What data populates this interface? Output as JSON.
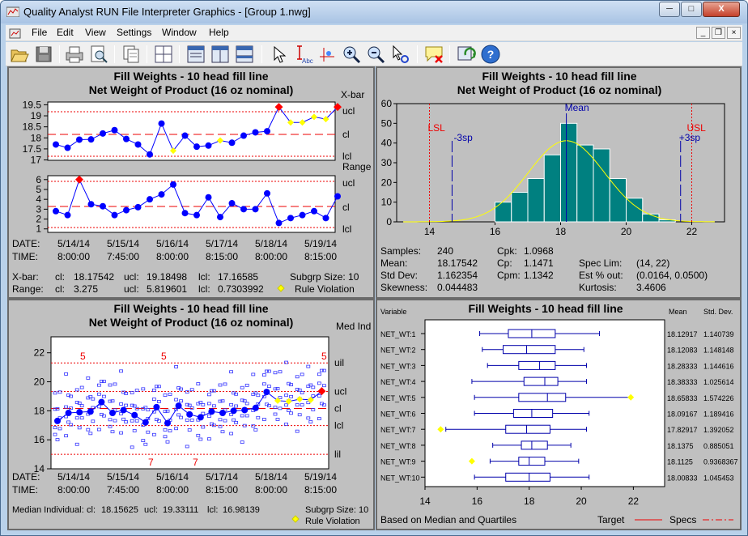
{
  "window": {
    "title": "Quality Analyst RUN File Interpreter Graphics - [Group 1.nwg]",
    "min": "─",
    "max": "□",
    "close": "X"
  },
  "menu": [
    "File",
    "Edit",
    "View",
    "Settings",
    "Window",
    "Help"
  ],
  "mdi": {
    "min": "_",
    "restore": "❐",
    "close": "×"
  },
  "toolbar": [
    "open-icon",
    "save-icon",
    "print-icon",
    "print-preview-icon",
    "copy-icon",
    "layout-grid-icon",
    "layout-single-icon",
    "layout-columns-icon",
    "layout-rows-icon",
    "pointer-icon",
    "text-annotation-icon",
    "point-label-icon",
    "zoom-in-icon",
    "zoom-out-icon",
    "select-point-icon",
    "clear-annotation-icon",
    "refresh-icon",
    "help-icon"
  ],
  "tooltext": {
    "abc": "Abc"
  },
  "xbar": {
    "title": "Fill Weights - 10 head fill line",
    "subtitle": "Net Weight of Product (16 oz nominal)",
    "chart_label": "X-bar",
    "range_label": "Range",
    "ticks": [
      "19.5",
      "19",
      "18.5",
      "18",
      "17.5",
      "17"
    ],
    "range_ticks": [
      "6",
      "5",
      "4",
      "3",
      "2",
      "1"
    ],
    "limits": {
      "ucl": "ucl",
      "cl": "cl",
      "lcl": "lcl"
    },
    "xbar_values": [
      17.7,
      17.55,
      17.92,
      17.93,
      18.2,
      18.35,
      17.95,
      17.7,
      17.25,
      18.65,
      17.42,
      18.1,
      17.6,
      17.65,
      17.88,
      17.78,
      18.1,
      18.25,
      18.3,
      19.4,
      18.7,
      18.7,
      18.95,
      18.85,
      19.4
    ],
    "range_values": [
      2.8,
      2.4,
      6.0,
      3.5,
      3.3,
      2.4,
      2.9,
      3.2,
      4.0,
      4.5,
      5.5,
      2.6,
      2.4,
      4.2,
      2.2,
      3.6,
      3.0,
      3.0,
      4.6,
      1.6,
      2.1,
      2.4,
      2.8,
      2.1,
      4.3
    ],
    "date_label": "DATE:",
    "time_label": "TIME:",
    "dates": [
      "5/14/14",
      "5/15/14",
      "5/16/14",
      "5/17/14",
      "5/18/14",
      "5/19/14"
    ],
    "times": [
      "8:00:00",
      "7:45:00",
      "8:00:00",
      "8:15:00",
      "8:00:00",
      "8:15:00"
    ],
    "stats": {
      "xbar": "X-bar:",
      "range": "Range:",
      "cl": "cl:",
      "ucl": "ucl:",
      "lcl": "lcl:",
      "xbar_cl": "18.17542",
      "xbar_ucl": "19.18498",
      "xbar_lcl": "17.16585",
      "range_cl": "3.275",
      "range_ucl": "5.819601",
      "range_lcl": "0.7303992",
      "subgrp": "Subgrp Size: 10",
      "rule": "Rule Violation"
    }
  },
  "histogram": {
    "title": "Fill Weights - 10 head fill line",
    "subtitle": "Net Weight of Product (16 oz nominal)",
    "yticks": [
      "60",
      "50",
      "40",
      "30",
      "20",
      "10",
      "0"
    ],
    "xticks": [
      "14",
      "16",
      "18",
      "20",
      "22"
    ],
    "labels": {
      "lsl": "LSL",
      "usl": "USL",
      "mean": "Mean",
      "m3": "-3sp",
      "p3": "+3sp"
    },
    "chart_data": {
      "type": "bar",
      "bins_start": 16,
      "bin_width": 0.5,
      "counts": [
        10,
        15,
        22,
        34,
        50,
        39,
        37,
        22,
        12,
        4,
        1
      ],
      "ylim": [
        0,
        60
      ],
      "xlim": [
        13,
        23
      ],
      "lsl": 14,
      "usl": 22,
      "mean": 18.17542,
      "minus3": 14.69,
      "plus3": 21.66
    },
    "stats": [
      [
        "Samples:",
        "240",
        "Cpk:",
        "1.0968",
        "",
        ""
      ],
      [
        "Mean:",
        "18.17542",
        "Cp:",
        "1.1471",
        "Spec Lim:",
        "(14, 22)"
      ],
      [
        "Std Dev:",
        "1.162354",
        "Cpm:",
        "1.1342",
        "Est % out:",
        "(0.0164, 0.0500)"
      ],
      [
        "Skewness:",
        "0.044483",
        "",
        "",
        "Kurtosis:",
        "3.4606"
      ]
    ]
  },
  "median": {
    "title": "Fill Weights - 10 head fill line",
    "subtitle": "Net Weight of Product (16 oz nominal)",
    "chart_label": "Med Ind",
    "yticks": [
      "22",
      "20",
      "18",
      "16",
      "14"
    ],
    "limits": {
      "uil": "uil",
      "ucl": "ucl",
      "cl": "cl",
      "lcl": "lcl",
      "lil": "lil"
    },
    "rule_top": [
      "5",
      "5",
      "5"
    ],
    "rule_bottom": [
      "7",
      "7"
    ],
    "median_values": [
      17.3,
      17.85,
      17.9,
      17.95,
      18.6,
      17.85,
      18.05,
      17.7,
      17.2,
      18.25,
      17.15,
      18.35,
      17.75,
      17.55,
      17.95,
      17.85,
      18.0,
      18.05,
      18.2,
      19.3,
      18.7,
      18.65,
      18.8,
      18.75,
      19.35
    ],
    "dates": [
      "5/14/14",
      "5/15/14",
      "5/16/14",
      "5/17/14",
      "5/18/14",
      "5/19/14"
    ],
    "times": [
      "8:00:00",
      "7:45:00",
      "8:00:00",
      "8:15:00",
      "8:00:00",
      "8:15:00"
    ],
    "date_label": "DATE:",
    "time_label": "TIME:",
    "stats": {
      "label": "Median Individual:",
      "cl": "cl:",
      "cl_v": "18.15625",
      "ucl": "ucl:",
      "ucl_v": "19.33111",
      "lcl": "lcl:",
      "lcl_v": "16.98139",
      "subgrp": "Subgrp Size: 10",
      "rule": "Rule Violation"
    }
  },
  "boxplot": {
    "title": "Fill Weights - 10 head fill line",
    "variable_label": "Variable",
    "mean_label": "Mean",
    "sd_label": "Std. Dev.",
    "xticks": [
      "14",
      "16",
      "18",
      "20",
      "22"
    ],
    "footer": "Based on Median and Quartiles",
    "target": "Target",
    "specs": "Specs",
    "rows": [
      {
        "name": "NET_WT:1",
        "mean": "18.12917",
        "sd": "1.140739",
        "min": 16.1,
        "q1": 17.2,
        "med": 18.1,
        "q3": 19.0,
        "max": 20.7
      },
      {
        "name": "NET_WT:2",
        "mean": "18.12083",
        "sd": "1.148148",
        "min": 16.2,
        "q1": 17.0,
        "med": 17.9,
        "q3": 19.0,
        "max": 20.1
      },
      {
        "name": "NET_WT:3",
        "mean": "18.28333",
        "sd": "1.144616",
        "min": 16.4,
        "q1": 17.6,
        "med": 18.4,
        "q3": 19.0,
        "max": 20.2
      },
      {
        "name": "NET_WT:4",
        "mean": "18.38333",
        "sd": "1.025614",
        "min": 15.8,
        "q1": 17.8,
        "med": 18.6,
        "q3": 19.1,
        "max": 20.2
      },
      {
        "name": "NET_WT:5",
        "mean": "18.65833",
        "sd": "1.574226",
        "min": 15.9,
        "q1": 17.6,
        "med": 18.7,
        "q3": 19.4,
        "max": 21.9,
        "out": 21.9
      },
      {
        "name": "NET_WT:6",
        "mean": "18.09167",
        "sd": "1.189416",
        "min": 15.9,
        "q1": 17.4,
        "med": 18.1,
        "q3": 18.9,
        "max": 20.3
      },
      {
        "name": "NET_WT:7",
        "mean": "17.82917",
        "sd": "1.392052",
        "min": 14.8,
        "q1": 17.1,
        "med": 17.9,
        "q3": 18.8,
        "max": 20.2,
        "out": 14.6
      },
      {
        "name": "NET_WT:8",
        "mean": "18.1375",
        "sd": "0.885051",
        "min": 16.6,
        "q1": 17.7,
        "med": 18.1,
        "q3": 18.7,
        "max": 19.6
      },
      {
        "name": "NET_WT:9",
        "mean": "18.1125",
        "sd": "0.9368367",
        "min": 16.5,
        "q1": 17.6,
        "med": 18.0,
        "q3": 18.6,
        "max": 19.9,
        "out": 15.8
      },
      {
        "name": "NET_WT:10",
        "mean": "18.00833",
        "sd": "1.045453",
        "min": 15.9,
        "q1": 17.1,
        "med": 18.0,
        "q3": 18.8,
        "max": 20.3
      }
    ]
  }
}
